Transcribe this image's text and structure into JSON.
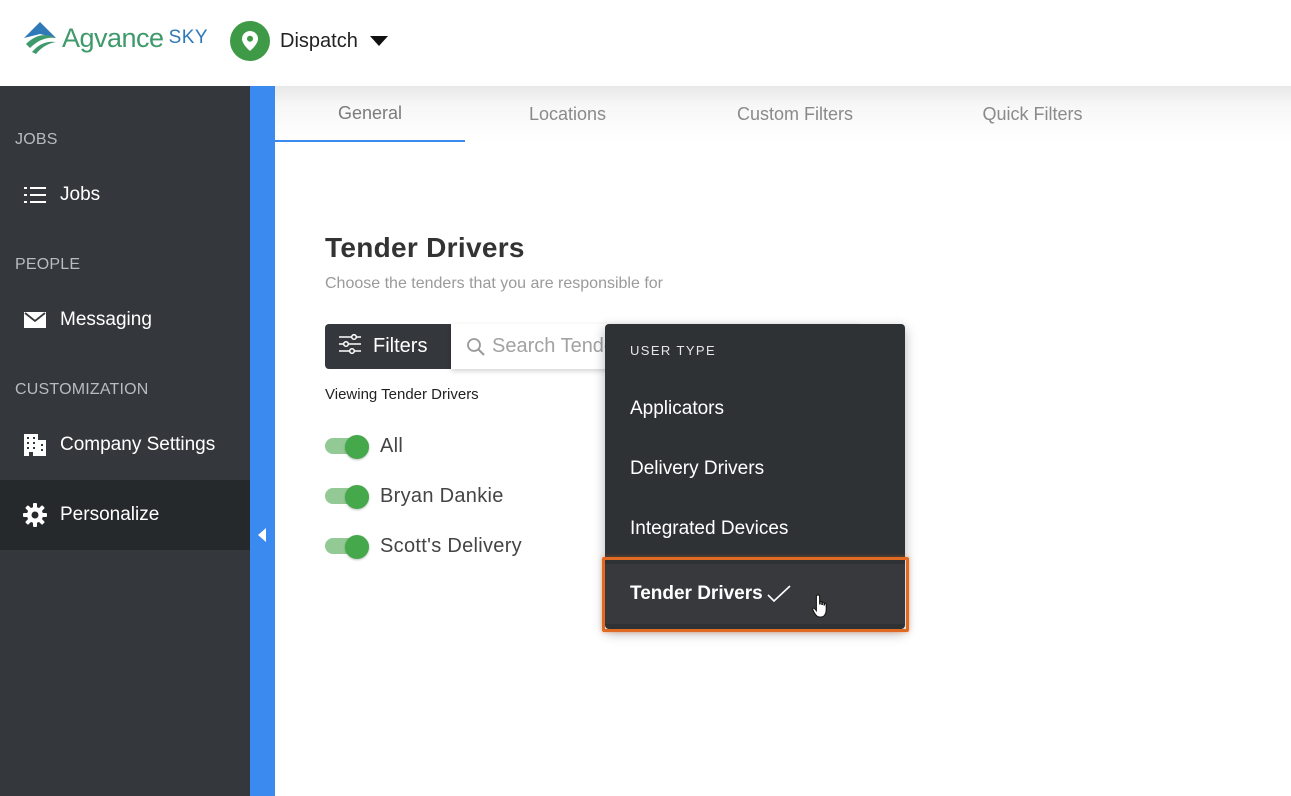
{
  "header": {
    "logo_text": "Agvance",
    "logo_sky": "SKY",
    "app_name": "Dispatch",
    "brand_green": "#3f9a47",
    "icons": {
      "logo": "agvance-logo-icon",
      "app": "location-pin-icon",
      "dropdown": "caret-down-icon"
    }
  },
  "sidebar": {
    "background": "#34373b",
    "sections": [
      {
        "title": "JOBS",
        "items": [
          {
            "label": "Jobs",
            "icon": "list-icon"
          }
        ]
      },
      {
        "title": "PEOPLE",
        "items": [
          {
            "label": "Messaging",
            "icon": "envelope-icon"
          }
        ]
      },
      {
        "title": "CUSTOMIZATION",
        "items": [
          {
            "label": "Company Settings",
            "icon": "building-icon"
          },
          {
            "label": "Personalize",
            "icon": "gear-icon",
            "active": true
          }
        ]
      }
    ],
    "collapse_icon": "chevron-left-icon",
    "collapse_color": "#3b8af0"
  },
  "tabs": [
    {
      "label": "General",
      "active": true
    },
    {
      "label": "Locations"
    },
    {
      "label": "Custom Filters"
    },
    {
      "label": "Quick Filters"
    }
  ],
  "main": {
    "title": "Tender Drivers",
    "subtitle": "Choose the tenders that you are responsible for",
    "filters_label": "Filters",
    "search_placeholder": "Search Tenders",
    "viewing_label": "Viewing Tender Drivers",
    "toggles": [
      {
        "label": "All",
        "on": true
      },
      {
        "label": "Bryan Dankie",
        "on": true
      },
      {
        "label": "Scott's Delivery",
        "on": true
      }
    ]
  },
  "dropdown": {
    "header": "USER TYPE",
    "options": [
      {
        "label": "Applicators",
        "selected": false
      },
      {
        "label": "Delivery Drivers",
        "selected": false
      },
      {
        "label": "Integrated Devices",
        "selected": false
      },
      {
        "label": "Tender Drivers",
        "selected": true
      }
    ],
    "highlight_color": "#e06a22"
  }
}
